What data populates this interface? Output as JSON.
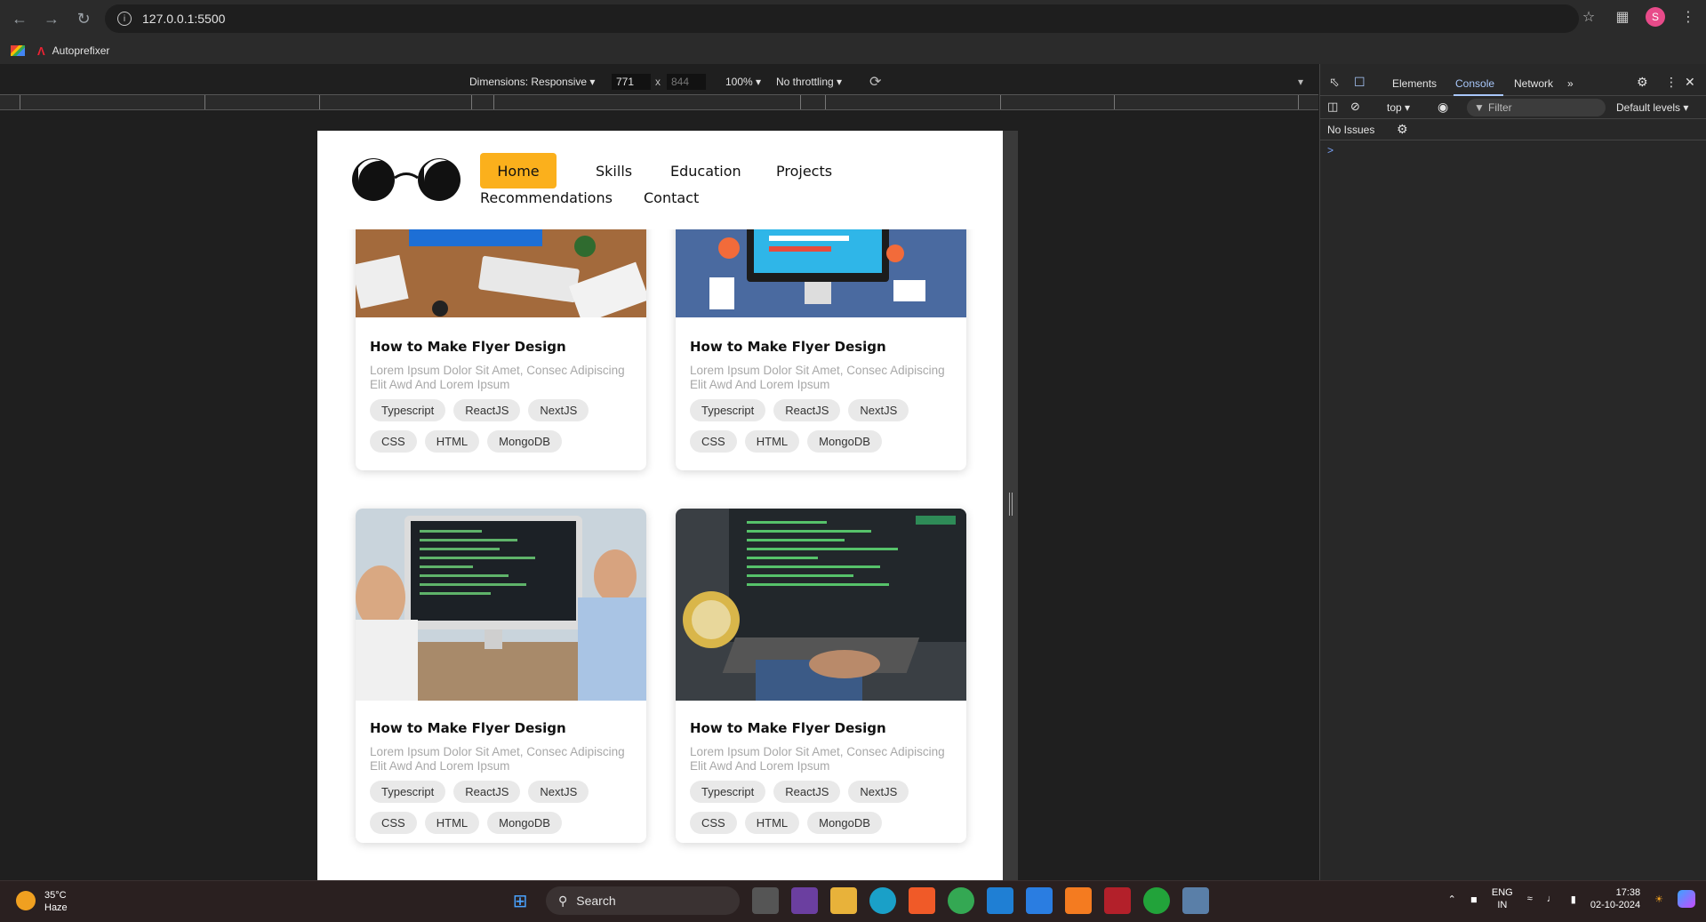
{
  "browser": {
    "url": "127.0.0.1:5500",
    "bookmark": "Autoprefixer",
    "profile_initial": "S"
  },
  "device_toolbar": {
    "dimensions": "Dimensions: Responsive",
    "width": "771",
    "times": "x",
    "height": "844",
    "zoom": "100%",
    "throttling": "No throttling"
  },
  "site": {
    "nav": {
      "home": "Home",
      "skills": "Skills",
      "education": "Education",
      "projects": "Projects",
      "recommendations": "Recommendations",
      "contact": "Contact"
    },
    "cards": [
      {
        "title": "How to Make Flyer Design",
        "desc": "Lorem Ipsum Dolor Sit Amet, Consec Adipiscing Elit Awd And Lorem Ipsum",
        "tags": [
          "Typescript",
          "ReactJS",
          "NextJS",
          "CSS",
          "HTML",
          "MongoDB"
        ]
      },
      {
        "title": "How to Make Flyer Design",
        "desc": "Lorem Ipsum Dolor Sit Amet, Consec Adipiscing Elit Awd And Lorem Ipsum",
        "tags": [
          "Typescript",
          "ReactJS",
          "NextJS",
          "CSS",
          "HTML",
          "MongoDB"
        ]
      },
      {
        "title": "How to Make Flyer Design",
        "desc": "Lorem Ipsum Dolor Sit Amet, Consec Adipiscing Elit Awd And Lorem Ipsum",
        "tags": [
          "Typescript",
          "ReactJS",
          "NextJS",
          "CSS",
          "HTML",
          "MongoDB"
        ]
      },
      {
        "title": "How to Make Flyer Design",
        "desc": "Lorem Ipsum Dolor Sit Amet, Consec Adipiscing Elit Awd And Lorem Ipsum",
        "tags": [
          "Typescript",
          "ReactJS",
          "NextJS",
          "CSS",
          "HTML",
          "MongoDB"
        ]
      }
    ]
  },
  "devtools": {
    "tabs": [
      "Elements",
      "Console",
      "Network"
    ],
    "active_tab": "Console",
    "context": "top",
    "filter_placeholder": "Filter",
    "levels": "Default levels",
    "issues": "No Issues",
    "prompt": ">"
  },
  "taskbar": {
    "temperature": "35°C",
    "weather": "Haze",
    "search": "Search",
    "lang_line1": "ENG",
    "lang_line2": "IN",
    "time": "17:38",
    "date": "02-10-2024"
  },
  "colors": {
    "accent": "#fbb01c",
    "devtools_active": "#a8c7fa"
  }
}
